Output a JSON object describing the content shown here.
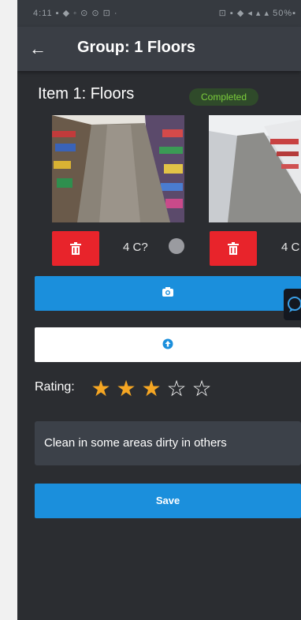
{
  "status_bar": {
    "left_text": "4:11 ▪ ◆ ◦ ⊙ ⊙ ⊡ ·",
    "right_text": "⊡ ▪ ◆ ◂ ▴ ▴ 50%▪"
  },
  "app_bar": {
    "back_icon": "arrow-left-icon",
    "title": "Group: 1 Floors"
  },
  "item": {
    "title": "Item 1: Floors",
    "status_badge": "Completed"
  },
  "photos": [
    {
      "count_label": "4 C?",
      "delete_icon": "trash-icon"
    },
    {
      "count_label": "4 C",
      "delete_icon": "trash-icon"
    }
  ],
  "actions": {
    "camera_icon": "camera-icon",
    "upload_icon": "upload-icon"
  },
  "rating": {
    "label": "Rating:",
    "value": 3,
    "max": 5,
    "stars": [
      "★",
      "★",
      "★",
      "☆",
      "☆"
    ]
  },
  "comment": {
    "value": "Clean in some areas dirty in others"
  },
  "save_button": {
    "label": "Save"
  },
  "colors": {
    "accent_blue": "#1b8fdc",
    "delete_red": "#e8242b",
    "star_filled": "#f5a623",
    "star_empty": "#ffffff",
    "badge_text": "#7ccf3c"
  }
}
